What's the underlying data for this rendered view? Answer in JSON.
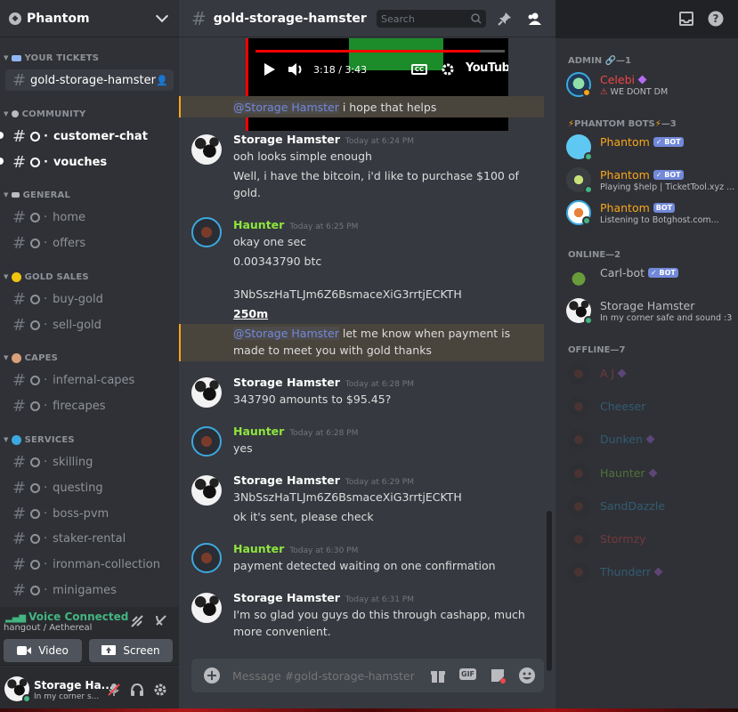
{
  "server": {
    "name": "Phantom"
  },
  "sidebar": {
    "categories": [
      {
        "label": "YOUR TICKETS",
        "emoji_color": "#8fb6f2"
      },
      {
        "label": "COMMUNITY",
        "emoji_color": "#b9bbbe"
      },
      {
        "label": "GENERAL",
        "emoji_color": "#b9bbbe"
      },
      {
        "label": "GOLD SALES",
        "emoji_color": "#f1c40f"
      },
      {
        "label": "CAPES",
        "emoji_color": "#d9a07a"
      },
      {
        "label": "SERVICES",
        "emoji_color": "#3ba9e0"
      }
    ],
    "channels": [
      {
        "name": "gold-storage-hamster",
        "state": "active"
      },
      {
        "name": "customer-chat",
        "state": "unread"
      },
      {
        "name": "vouches",
        "state": "unread"
      },
      {
        "name": "home",
        "state": "normal"
      },
      {
        "name": "offers",
        "state": "normal"
      },
      {
        "name": "buy-gold",
        "state": "normal"
      },
      {
        "name": "sell-gold",
        "state": "normal"
      },
      {
        "name": "infernal-capes",
        "state": "normal"
      },
      {
        "name": "firecapes",
        "state": "normal"
      },
      {
        "name": "skilling",
        "state": "normal"
      },
      {
        "name": "questing",
        "state": "normal"
      },
      {
        "name": "boss-pvm",
        "state": "normal"
      },
      {
        "name": "staker-rental",
        "state": "normal"
      },
      {
        "name": "ironman-collection",
        "state": "normal"
      },
      {
        "name": "minigames",
        "state": "normal"
      }
    ]
  },
  "voice": {
    "title": "Voice Connected",
    "subtitle": "hangout / Aethereal",
    "video_label": "Video",
    "screen_label": "Screen"
  },
  "user": {
    "name": "Storage Ha...",
    "status": "In my corner s..."
  },
  "chat": {
    "channel": "gold-storage-hamster",
    "search_placeholder": "Search",
    "composer_placeholder": "Message #gold-storage-hamster",
    "video": {
      "time": "3:18 / 3:43",
      "brand": "YouTube",
      "progress": 0.9
    }
  },
  "messages": [
    {
      "type": "continuation",
      "highlight": true,
      "mention": "@Storage Hamster",
      "text": " i hope that helps"
    },
    {
      "author": "Storage Hamster",
      "color": "#ffffff",
      "time": "Today at 6:24 PM",
      "lines": [
        "ooh looks simple enough",
        "Well, i have the bitcoin, i'd like to purchase $100 of",
        "gold."
      ]
    },
    {
      "author": "Haunter",
      "color": "#8ee53f",
      "time": "Today at 6:25 PM",
      "lines": [
        "okay one sec",
        "0.00343790 btc",
        "3NbSszHaTLJm6Z6BsmaceXiG3rrtjECKTH",
        "250m"
      ]
    },
    {
      "type": "continuation",
      "highlight": true,
      "mention": "@Storage Hamster",
      "text": " let me know when payment is",
      "text2": "made to meet you with gold thanks"
    },
    {
      "author": "Storage Hamster",
      "color": "#ffffff",
      "time": "Today at 6:28 PM",
      "lines": [
        "343790 amounts to $95.45?"
      ]
    },
    {
      "author": "Haunter",
      "color": "#8ee53f",
      "time": "Today at 6:28 PM",
      "lines": [
        "yes"
      ]
    },
    {
      "author": "Storage Hamster",
      "color": "#ffffff",
      "time": "Today at 6:29 PM",
      "lines": [
        "3NbSszHaTLJm6Z6BsmaceXiG3rrtjECKTH",
        "ok it's sent, please check"
      ]
    },
    {
      "author": "Haunter",
      "color": "#8ee53f",
      "time": "Today at 6:30 PM",
      "lines": [
        "payment detected waiting on one confirmation"
      ]
    },
    {
      "author": "Storage Hamster",
      "color": "#ffffff",
      "time": "Today at 6:31 PM",
      "lines": [
        "I'm so glad you guys do this through cashapp, much",
        "more convenient."
      ]
    }
  ],
  "members": {
    "admin_label": "ADMIN",
    "admin_count": "—1",
    "bots_label": "PHANTOM BOTS",
    "bots_count": "—3",
    "online_label": "ONLINE—2",
    "offline_label": "OFFLINE—7",
    "bot_badge": "BOT",
    "admin": [
      {
        "name": "Celebi",
        "color": "#f04747",
        "status": "WE DONT DM"
      }
    ],
    "bots": [
      {
        "name": "Phantom",
        "color": "#faa61a",
        "status": ""
      },
      {
        "name": "Phantom",
        "color": "#faa61a",
        "status": "Playing $help | TicketTool.xyz ..."
      },
      {
        "name": "Phantom",
        "color": "#faa61a",
        "status": "Listening to Botghost.com..."
      }
    ],
    "online": [
      {
        "name": "Carl-bot",
        "color": "#b9bbbe",
        "status": ""
      },
      {
        "name": "Storage Hamster",
        "color": "#b9bbbe",
        "status": "In my corner safe and sound :3"
      }
    ],
    "offline": [
      {
        "name": "A J",
        "color": "#f04747"
      },
      {
        "name": "Cheeser",
        "color": "#3ba9e0"
      },
      {
        "name": "Dunken",
        "color": "#3ba9e0"
      },
      {
        "name": "Haunter",
        "color": "#8ee53f"
      },
      {
        "name": "SandDazzle",
        "color": "#3ba9e0"
      },
      {
        "name": "Stormzy",
        "color": "#f04747"
      },
      {
        "name": "Thunderr",
        "color": "#3ba9e0"
      }
    ]
  }
}
